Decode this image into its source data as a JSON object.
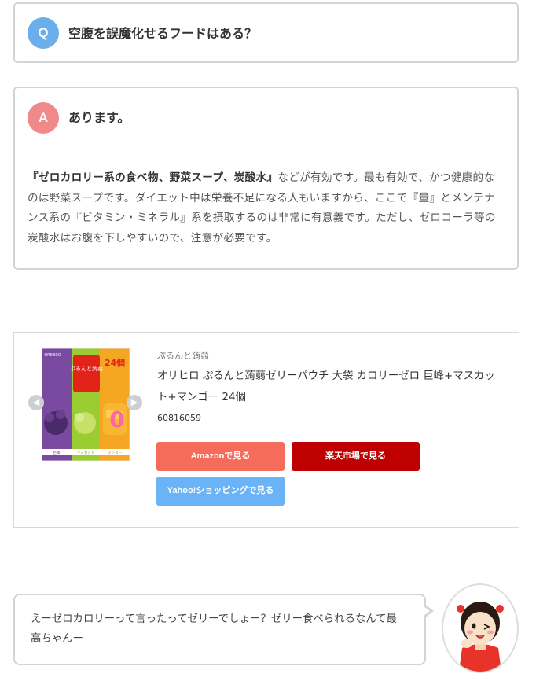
{
  "qa": {
    "question": {
      "badge": "Q",
      "text": "空腹を誤魔化せるフードはある？",
      "badge_color": "#6aaeeb"
    },
    "answer": {
      "badge": "A",
      "title": "あります。",
      "badge_color": "#f08a8a",
      "body_bold": "『ゼロカロリー系の食べ物、野菜スープ、炭酸水』",
      "body_rest": "などが有効です。最も有効で、かつ健康的なのは野菜スープです。ダイエット中は栄養不足になる人もいますから、ここで『量』とメンテナンス系の『ビタミン・ミネラル』系を摂取するのは非常に有意義です。ただし、ゼロコーラ等の炭酸水はお腹を下しやすいので、注意が必要です。"
    }
  },
  "product": {
    "brand": "ぷるんと蒟蒻",
    "name": "オリヒロ ぷるんと蒟蒻ゼリーパウチ 大袋 カロリーゼロ 巨峰+マスカット+マンゴー 24個",
    "id": "60816059",
    "image_text": {
      "maker": "ORIHIRO",
      "product_line": "ぷるんと蒟蒻",
      "count": "24個",
      "zero_label": "0",
      "flavors": [
        "巨峰",
        "マスカット",
        "マンゴー"
      ]
    },
    "buttons": {
      "amazon": "Amazonで見る",
      "rakuten": "楽天市場で見る",
      "yahoo": "Yahoo!ショッピングで見る"
    },
    "button_colors": {
      "amazon": "#f56c5a",
      "rakuten": "#bf0000",
      "yahoo": "#6bb3f7"
    },
    "icons": {
      "prev": "chevron-left-icon",
      "next": "chevron-right-icon"
    }
  },
  "speech": {
    "text": "えーゼロカロリーって言ったってゼリーでしょー？ゼリー食べられるなんて最高ちゃんー"
  }
}
